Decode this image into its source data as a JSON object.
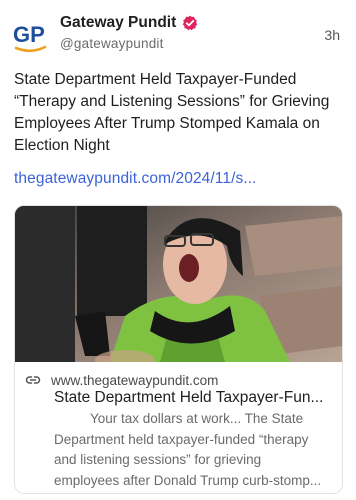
{
  "author": {
    "name": "Gateway Pundit",
    "handle": "@gatewaypundit",
    "avatar_text": "GP",
    "verified_color": "#e0245e"
  },
  "time": "3h",
  "post": {
    "text": "State Department Held Taxpayer-Funded “Therapy and Listening Sessions” for Grieving Employees After Trump Stomped Kamala on Election Night",
    "link": "thegatewaypundit.com/2024/11/s..."
  },
  "card": {
    "image_icon": "crying-protester-photo",
    "domain": "www.thegatewaypundit.com",
    "title": "State Department Held Taxpayer-Fun...",
    "description": "Your tax dollars at work... The State Department held taxpayer-funded “therapy and listening sessions” for grieving",
    "description_last": "employees after Donald Trump curb-stomp..."
  },
  "colors": {
    "link": "#3b63d8",
    "avatar_blue": "#1f4e9c",
    "avatar_orange": "#f0a020"
  }
}
